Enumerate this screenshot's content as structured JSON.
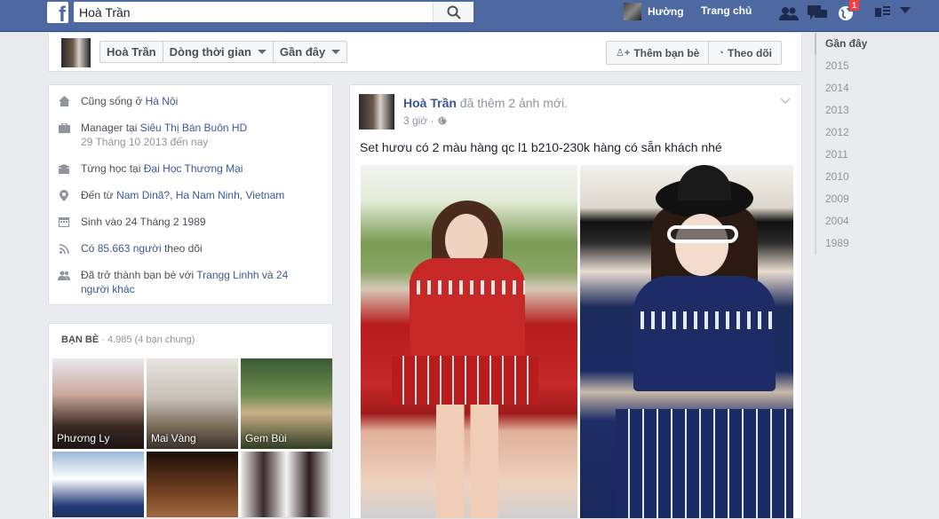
{
  "topbar": {
    "search_value": "Hoà Trần",
    "user_name": "Hường",
    "home_label": "Trang chủ",
    "notifications_count": "1",
    "brand_color": "#4e69a2"
  },
  "profile_header": {
    "name": "Hoà Trần",
    "timeline_label": "Dòng thời gian",
    "recent_label": "Gần đây",
    "add_friend_label": "Thêm bạn bè",
    "follow_label": "Theo dõi"
  },
  "timeline_nav": [
    "Gần đây",
    "2015",
    "2014",
    "2013",
    "2012",
    "2011",
    "2010",
    "2009",
    "2004",
    "1989"
  ],
  "about": {
    "lives_prefix": "Cũng sống ở ",
    "lives_city": "Hà Nội",
    "work_prefix": "Manager tại ",
    "work_place": "Siêu Thị Bán Buôn HD",
    "work_since": "29 Tháng 10 2013 đến nay",
    "study_prefix": "Từng học tại ",
    "study_place": "Đại Học Thương Mại",
    "from_prefix": "Đến từ ",
    "from_place": "Nam Dinã?, Ha Nam Ninh, Vietnam",
    "born": "Sinh vào 24 Tháng 2 1989",
    "followers_prefix": "Có ",
    "followers_link": "85.663 người",
    "followers_suffix": " theo dõi",
    "friends_since_prefix": "Đã trở thành bạn bè với ",
    "friends_since_name": "Trangg Linhh",
    "friends_since_mid": " và ",
    "friends_since_others": "24 người khác"
  },
  "friends": {
    "title": "Bạn bè",
    "meta": " · 4.985 (4 bạn chung)",
    "items": [
      {
        "name": "Phương Ly"
      },
      {
        "name": "Mai Vàng"
      },
      {
        "name": "Gem Bùi"
      },
      {
        "name": ""
      },
      {
        "name": ""
      },
      {
        "name": ""
      }
    ]
  },
  "post": {
    "author": "Hoà Trần",
    "action": " đã thêm 2 ảnh mới.",
    "time": "3 giờ ·",
    "text": "Set hươu có 2 màu hàng qc l1 b210-230k hàng có sẵn khách nhé"
  }
}
